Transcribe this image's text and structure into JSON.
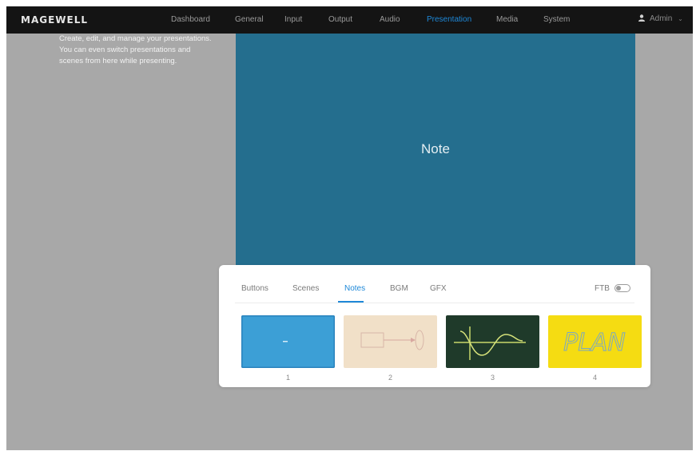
{
  "header": {
    "logo": "MAGEWELL",
    "nav": [
      {
        "label": "Dashboard",
        "active": false
      },
      {
        "label": "General",
        "active": false
      },
      {
        "label": "Input",
        "active": false
      },
      {
        "label": "Output",
        "active": false
      },
      {
        "label": "Audio",
        "active": false
      },
      {
        "label": "Presentation",
        "active": true
      },
      {
        "label": "Media",
        "active": false
      },
      {
        "label": "System",
        "active": false
      }
    ],
    "user": {
      "icon": "user-icon",
      "label": "Admin"
    }
  },
  "description": "Create, edit, and manage your presentations. You can even switch presentations and scenes from here while presenting.",
  "preview": {
    "label": "Note",
    "color": "#246e8e"
  },
  "panel": {
    "tabs": [
      {
        "label": "Buttons",
        "active": false
      },
      {
        "label": "Scenes",
        "active": false
      },
      {
        "label": "Notes",
        "active": true
      },
      {
        "label": "BGM",
        "active": false
      },
      {
        "label": "GFX",
        "active": false
      }
    ],
    "ftb": {
      "label": "FTB",
      "enabled": false
    },
    "notes": [
      {
        "number": "1",
        "icon": "blue-note-thumbnail"
      },
      {
        "number": "2",
        "icon": "sketch-diagram-thumbnail"
      },
      {
        "number": "3",
        "icon": "chalkboard-wave-thumbnail"
      },
      {
        "number": "4",
        "icon": "plan-text-thumbnail",
        "text": "PLAN"
      }
    ]
  },
  "colors": {
    "accent": "#1e88d8",
    "topbar": "#141414",
    "overlay": "#a8a8a8"
  }
}
